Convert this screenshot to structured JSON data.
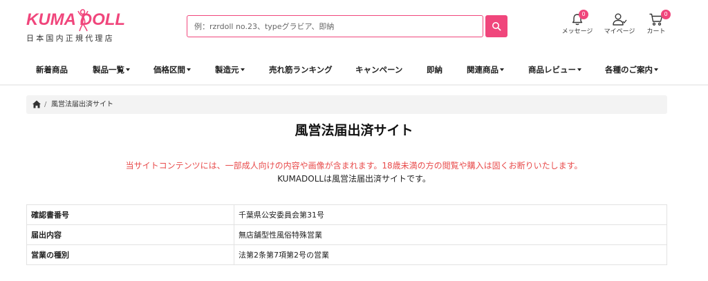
{
  "header": {
    "logo_text": "KUMA DOLL",
    "logo_sub": "日本国内正規代理店",
    "search_placeholder": "例：rzrdoll no.23、typeグラビア、即納",
    "icons": [
      {
        "name": "bell-icon",
        "label": "メッセージ",
        "badge": "0"
      },
      {
        "name": "user-icon",
        "label": "マイページ",
        "badge": null
      },
      {
        "name": "cart-icon",
        "label": "カート",
        "badge": "0"
      }
    ],
    "accent_color": "#f0467c"
  },
  "nav": {
    "items": [
      {
        "label": "新着商品",
        "dropdown": false
      },
      {
        "label": "製品一覧",
        "dropdown": true
      },
      {
        "label": "価格区間",
        "dropdown": true
      },
      {
        "label": "製造元",
        "dropdown": true
      },
      {
        "label": "売れ筋ランキング",
        "dropdown": false
      },
      {
        "label": "キャンペーン",
        "dropdown": false
      },
      {
        "label": "即納",
        "dropdown": false
      },
      {
        "label": "関連商品",
        "dropdown": true
      },
      {
        "label": "商品レビュー",
        "dropdown": true
      },
      {
        "label": "各種のご案内",
        "dropdown": true
      }
    ]
  },
  "breadcrumb": {
    "separator": "/",
    "current": "風営法届出済サイト"
  },
  "main": {
    "title": "風営法届出済サイト",
    "notice": "当サイトコンテンツには、一部成人向けの内容や画像が含まれます。18歳未満の方の閲覧や購入は固くお断りいたします。",
    "notice2": "KUMADOLLは風営法届出済サイトです。",
    "notice_color": "#e84a4a",
    "table": [
      {
        "label": "確認書番号",
        "value": "千葉県公安委員会第31号"
      },
      {
        "label": "届出内容",
        "value": "無店舗型性風俗特殊営業"
      },
      {
        "label": "営業の種別",
        "value": "法第2条第7項第2号の営業"
      }
    ]
  }
}
